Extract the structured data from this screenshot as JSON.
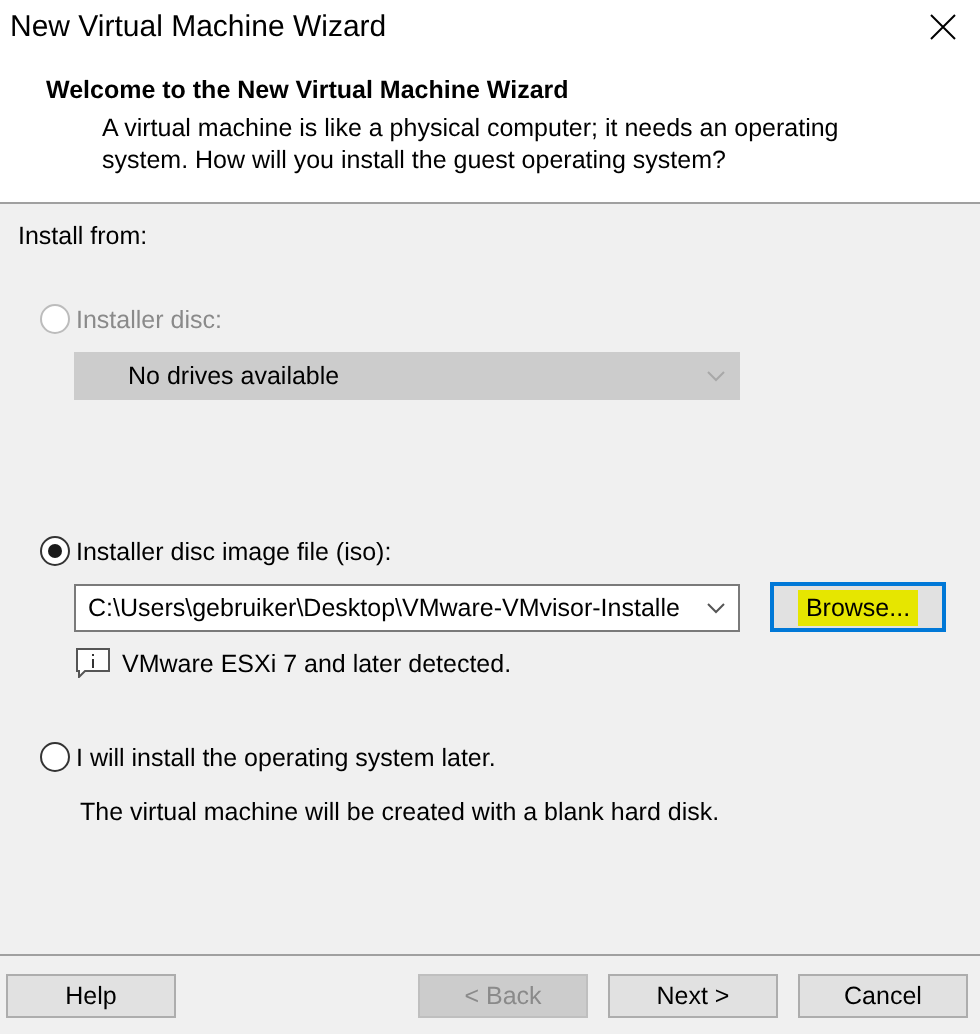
{
  "window": {
    "title": "New Virtual Machine Wizard"
  },
  "header": {
    "title": "Welcome to the New Virtual Machine Wizard",
    "description": "A virtual machine is like a physical computer; it needs an operating system. How will you install the guest operating system?"
  },
  "install_from": "Install from:",
  "options": [
    {
      "kind": "drive",
      "label": "Installer disc:",
      "selected": false,
      "disabled": true,
      "dropdown": {
        "value": "No drives available",
        "disabled": true
      }
    },
    {
      "kind": "iso",
      "label": "Installer disc image file (iso):",
      "selected": true,
      "disabled": false,
      "path": "C:\\Users\\gebruiker\\Desktop\\VMware-VMvisor-Installe",
      "browse": {
        "label": "Browse...",
        "focused": true,
        "highlighted": true
      },
      "note": "VMware ESXi 7 and later detected."
    },
    {
      "kind": "later",
      "label": "I will install the operating system later.",
      "selected": false,
      "disabled": false,
      "description": "The virtual machine will be created with a blank hard disk."
    }
  ],
  "buttons": [
    {
      "label": "Help",
      "disabled": false
    },
    {
      "label": "< Back",
      "disabled": true
    },
    {
      "label": "Next >",
      "disabled": false
    },
    {
      "label": "Cancel",
      "disabled": false
    }
  ]
}
